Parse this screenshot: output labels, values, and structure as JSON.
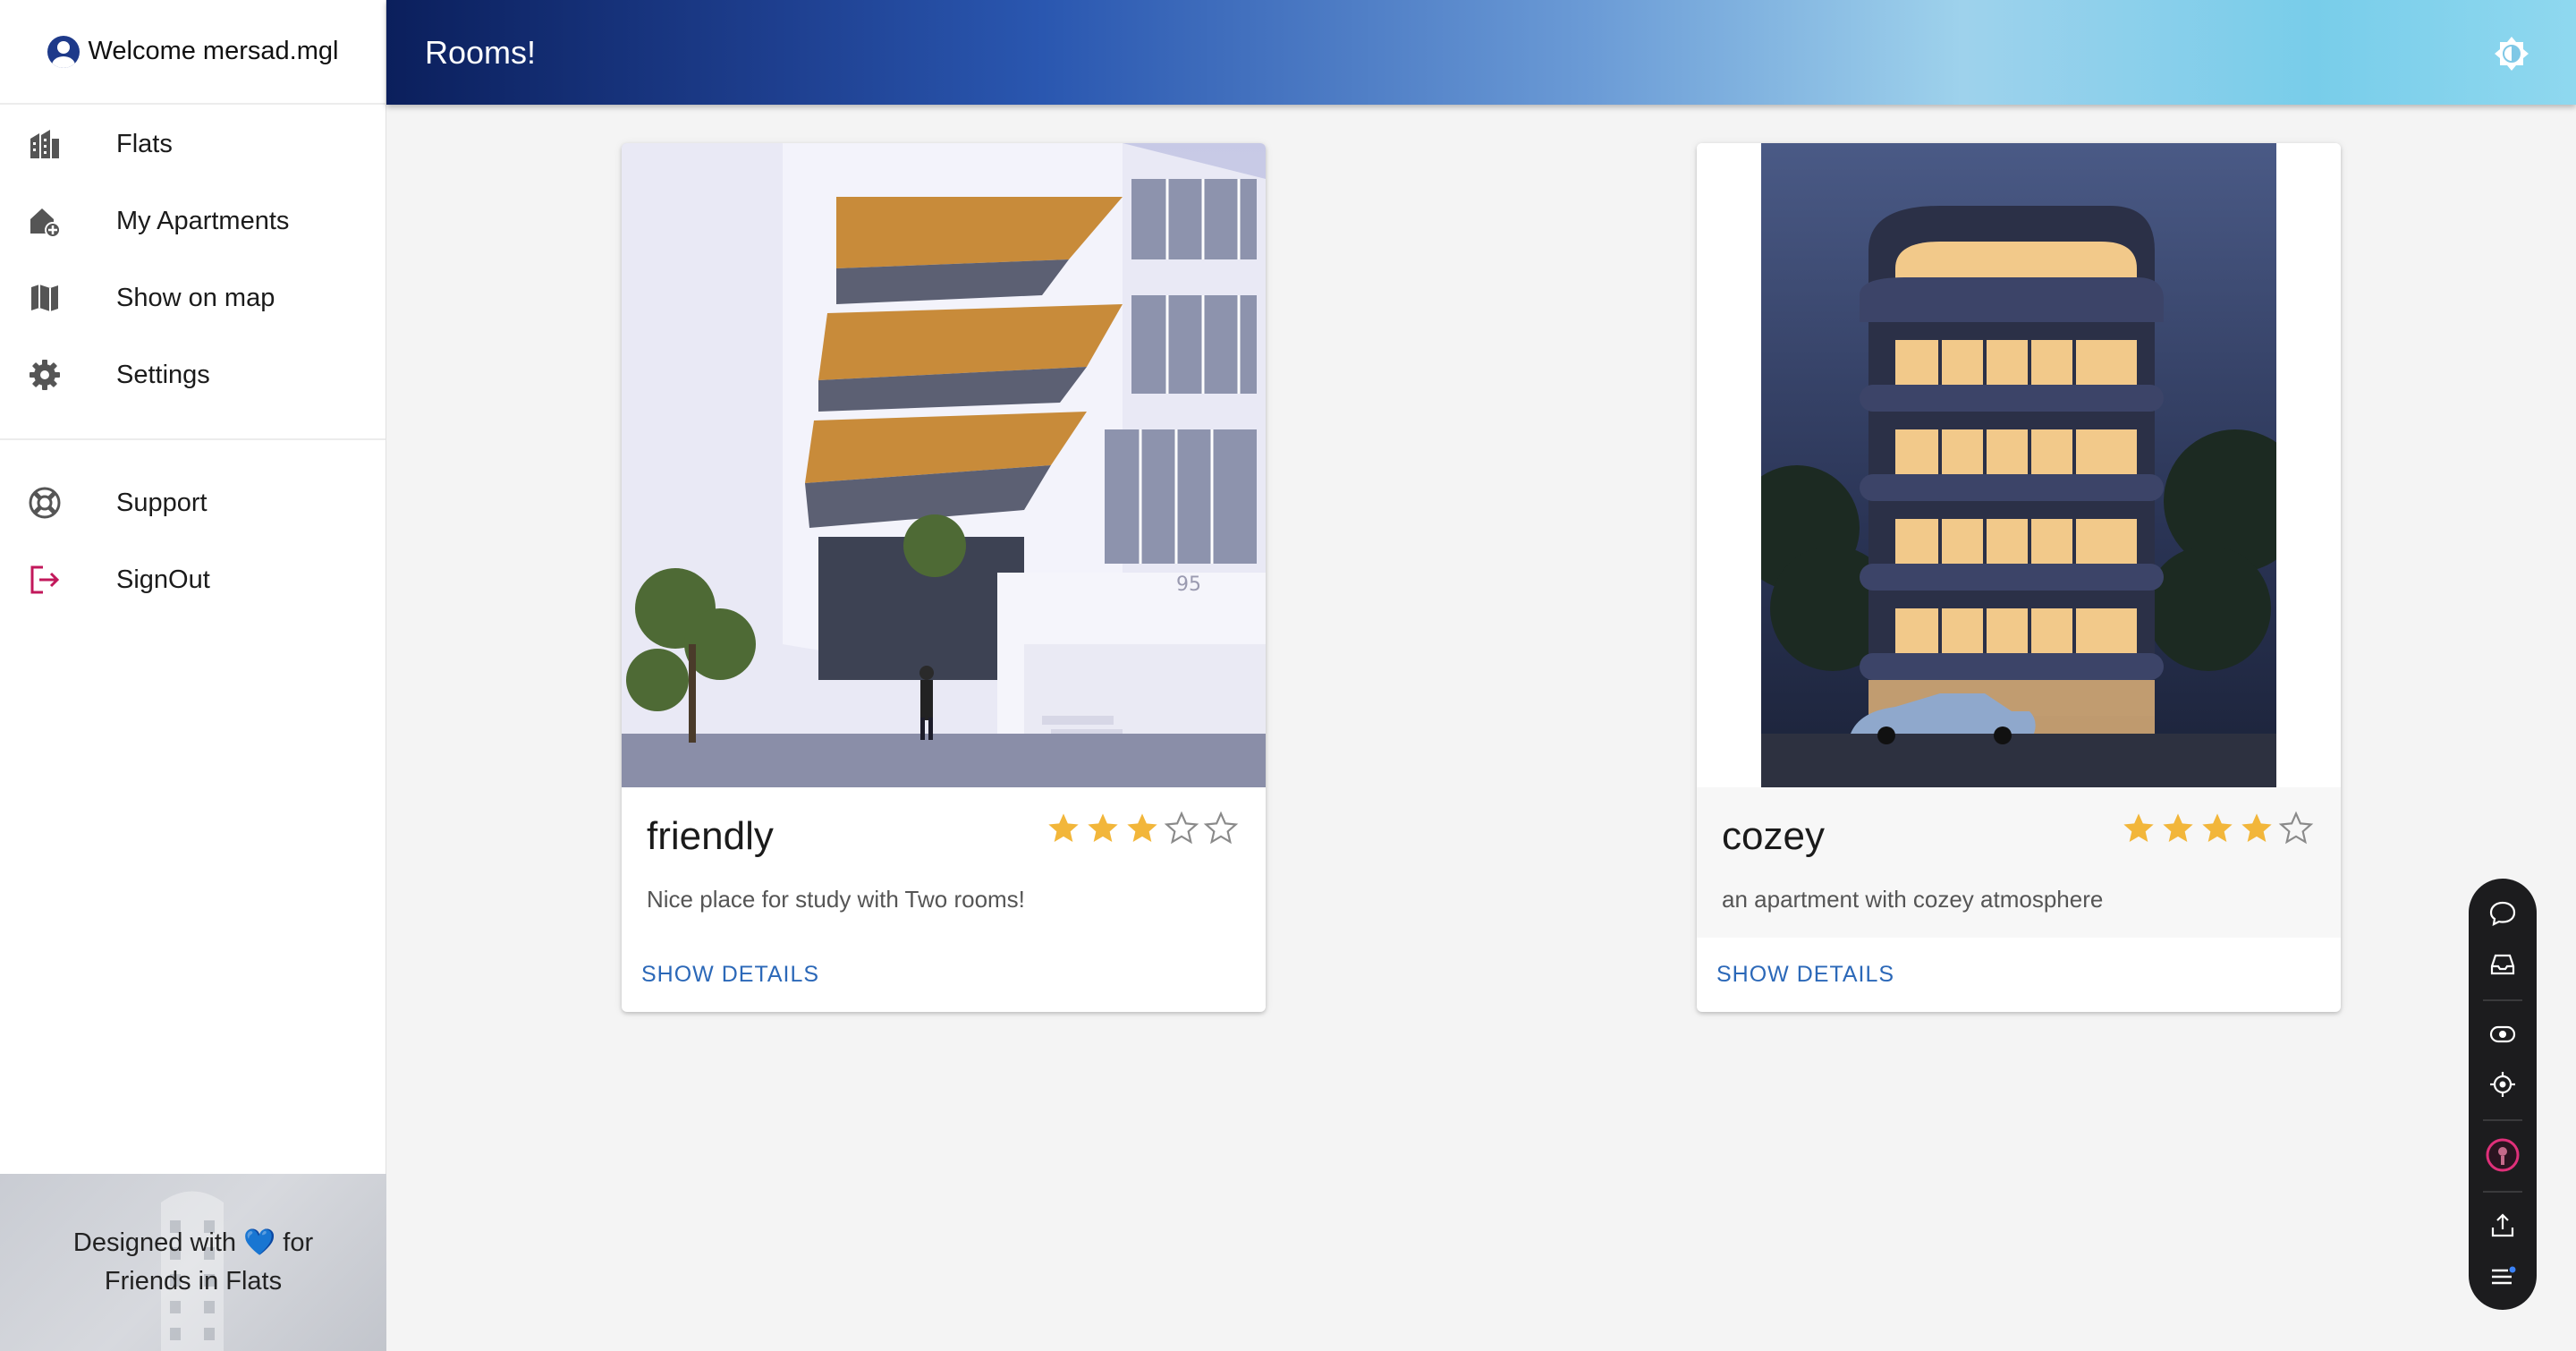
{
  "sidebar": {
    "welcome": "Welcome mersad.mgl",
    "items": [
      {
        "label": "Flats",
        "icon": "buildings-icon"
      },
      {
        "label": "My Apartments",
        "icon": "home-add-icon"
      },
      {
        "label": "Show on map",
        "icon": "map-icon"
      },
      {
        "label": "Settings",
        "icon": "gear-icon"
      }
    ],
    "secondary": [
      {
        "label": "Support",
        "icon": "lifebuoy-icon"
      },
      {
        "label": "SignOut",
        "icon": "logout-icon"
      }
    ],
    "footer": {
      "line1_prefix": "Designed with",
      "heart": "💙",
      "line1_suffix": "for",
      "line2": "Friends in Flats"
    }
  },
  "header": {
    "title": "Rooms!",
    "theme_icon": "brightness-icon"
  },
  "cards": [
    {
      "title": "friendly",
      "description": "Nice place for study with Two rooms!",
      "rating": 3,
      "max_rating": 5,
      "action": "SHOW DETAILS"
    },
    {
      "title": "cozey",
      "description": "an apartment with cozey atmosphere",
      "rating": 4,
      "max_rating": 5,
      "action": "SHOW DETAILS"
    }
  ],
  "toolbar": {
    "icons": [
      "comment-icon",
      "inbox-icon",
      "eye-icon",
      "target-icon",
      "avatar-icon",
      "upload-icon",
      "menu-icon"
    ]
  },
  "colors": {
    "star": "#f2b63a",
    "link": "#2b68b8",
    "signout": "#c2185b"
  }
}
